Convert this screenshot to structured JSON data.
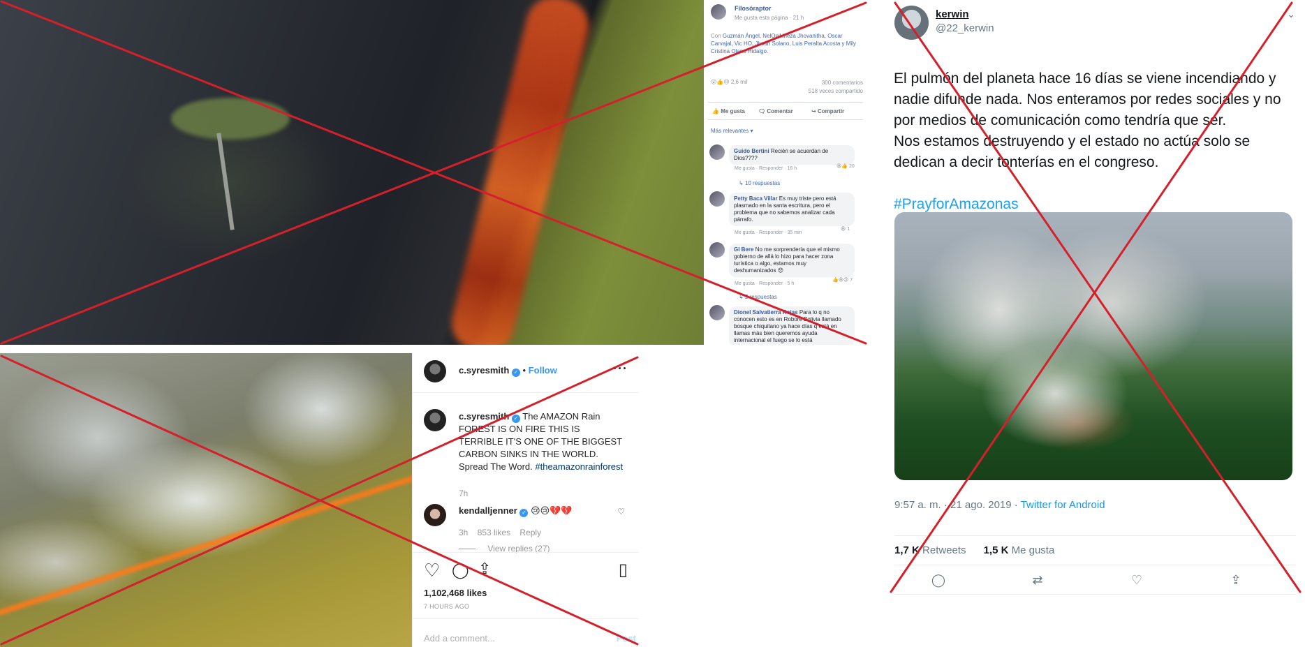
{
  "facebook": {
    "page_name": "Filosóraptor",
    "liked_status": "Me gusta esta página",
    "time": "21 h",
    "with_label": "Con",
    "tagged_people": "Guzmán Ángel, NelOpikineza Jhovanitha, Oscar Carvajal, Vic HO, Jhoan Solano, Luis Peralta Acosta y Mily Cristina Olano Hidalgo.",
    "reactions_count": "2,6 mil",
    "comments_count": "300 comentarios",
    "shares_count": "518 veces compartido",
    "actions": {
      "like": "Me gusta",
      "comment": "Comentar",
      "share": "Compartir"
    },
    "sort_label": "Más relevantes",
    "comments": [
      {
        "author": "Guido Bertini",
        "text": "Recién se acuerdan de Dios????",
        "like": "Me gusta",
        "reply": "Responder",
        "time": "16 h",
        "reactions": "20",
        "replies": "10 respuestas"
      },
      {
        "author": "Petty Baca Villar",
        "text": "Es muy triste pero está plasmado en la santa escritura, pero el problema que no sabemos analizar cada párrafo.",
        "like": "Me gusta",
        "reply": "Responder",
        "time": "35 min",
        "reactions": "1"
      },
      {
        "author": "Gl Bere",
        "text": "No me sorprendería que el mismo gobierno de allá lo hizo para hacer zona turística o algo, estamos muy deshumanizados 😞",
        "like": "Me gusta",
        "reply": "Responder",
        "time": "5 h",
        "reactions": "7",
        "replies": "2 respuestas"
      },
      {
        "author": "Dionel Salvatierra Rojas",
        "text": "Para lo q no conocen esto es en Roboré Bolivia llamado bosque chiquitano ya hace días q está en llamas más bien queremos ayuda internacional el fuego se lo está"
      }
    ]
  },
  "instagram": {
    "username": "c.syresmith",
    "follow": "Follow",
    "caption": "The AMAZON Rain FOREST IS ON FIRE THIS IS TERRIBLE IT'S ONE OF THE BIGGEST CARBON SINKS IN THE WORLD. Spread The Word.",
    "hashtag": "#theamazonrainforest",
    "caption_time": "7h",
    "comment": {
      "author": "kendalljenner",
      "text": "😢😢💔💔",
      "time": "3h",
      "likes": "853 likes",
      "reply": "Reply",
      "view_replies": "View replies (27)"
    },
    "likes": "1,102,468 likes",
    "posted": "7 HOURS AGO",
    "add_comment_placeholder": "Add a comment...",
    "post_button": "Post"
  },
  "twitter": {
    "display_name": "kerwin",
    "handle": "@22_kerwin",
    "text": "El pulmón del planeta hace 16 días se viene incendiando y nadie difunde nada. Nos enteramos por redes sociales y no por medios de comunicación como tendría que ser.\nNos estamos destruyendo y el estado no actúa solo se dedican a decir tonterías en el congreso.",
    "hashtag": "#PrayforAmazonas",
    "timestamp": "9:57 a. m. · 21 ago. 2019 ·",
    "source": "Twitter for Android",
    "retweets_count": "1,7 K",
    "retweets_label": "Retweets",
    "likes_count": "1,5 K",
    "likes_label": "Me gusta"
  },
  "colors": {
    "cross": "#d3202a",
    "fb_link": "#385898",
    "tw_blue": "#1da1f2"
  }
}
